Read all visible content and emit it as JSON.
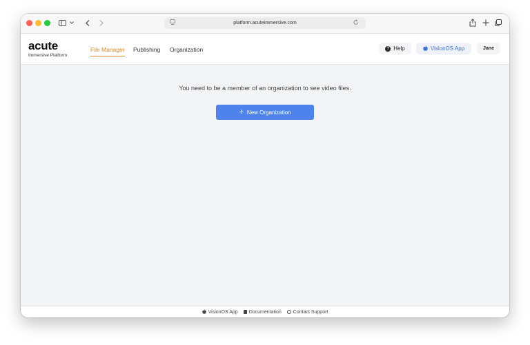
{
  "browser": {
    "url": "platform.acuteimmersive.com",
    "icons": [
      "sidebar-icon",
      "chevron-down-icon",
      "back-icon",
      "forward-icon",
      "page-menu-icon",
      "reload-icon",
      "share-icon",
      "new-tab-icon",
      "tabs-overview-icon"
    ]
  },
  "header": {
    "logo_title": "acute",
    "logo_subtitle": "Immersive Platform",
    "nav": [
      {
        "label": "File Manager",
        "active": true
      },
      {
        "label": "Publishing",
        "active": false
      },
      {
        "label": "Organization",
        "active": false
      }
    ],
    "help_label": "Help",
    "vision_label": "VisionOS App",
    "user_label": "Jane"
  },
  "main": {
    "message": "You need to be a member of an organization to see video files.",
    "new_org_label": "New Organization"
  },
  "footer": {
    "vision_label": "VisionOS App",
    "docs_label": "Documentation",
    "support_label": "Contact Support"
  },
  "colors": {
    "accent": "#d9821e",
    "primary_button": "#4f83ec",
    "vision_text": "#3b6fd8",
    "background": "#f3f4f6"
  }
}
